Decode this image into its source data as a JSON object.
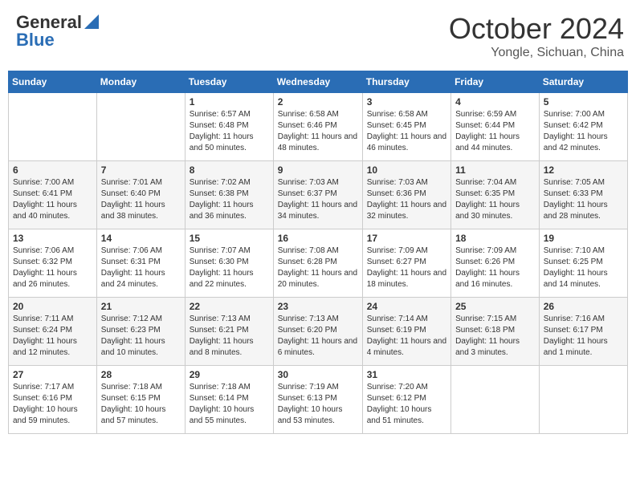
{
  "header": {
    "logo_general": "General",
    "logo_blue": "Blue",
    "month_title": "October 2024",
    "location": "Yongle, Sichuan, China"
  },
  "weekdays": [
    "Sunday",
    "Monday",
    "Tuesday",
    "Wednesday",
    "Thursday",
    "Friday",
    "Saturday"
  ],
  "weeks": [
    [
      {
        "day": "",
        "sunrise": "",
        "sunset": "",
        "daylight": ""
      },
      {
        "day": "",
        "sunrise": "",
        "sunset": "",
        "daylight": ""
      },
      {
        "day": "1",
        "sunrise": "Sunrise: 6:57 AM",
        "sunset": "Sunset: 6:48 PM",
        "daylight": "Daylight: 11 hours and 50 minutes."
      },
      {
        "day": "2",
        "sunrise": "Sunrise: 6:58 AM",
        "sunset": "Sunset: 6:46 PM",
        "daylight": "Daylight: 11 hours and 48 minutes."
      },
      {
        "day": "3",
        "sunrise": "Sunrise: 6:58 AM",
        "sunset": "Sunset: 6:45 PM",
        "daylight": "Daylight: 11 hours and 46 minutes."
      },
      {
        "day": "4",
        "sunrise": "Sunrise: 6:59 AM",
        "sunset": "Sunset: 6:44 PM",
        "daylight": "Daylight: 11 hours and 44 minutes."
      },
      {
        "day": "5",
        "sunrise": "Sunrise: 7:00 AM",
        "sunset": "Sunset: 6:42 PM",
        "daylight": "Daylight: 11 hours and 42 minutes."
      }
    ],
    [
      {
        "day": "6",
        "sunrise": "Sunrise: 7:00 AM",
        "sunset": "Sunset: 6:41 PM",
        "daylight": "Daylight: 11 hours and 40 minutes."
      },
      {
        "day": "7",
        "sunrise": "Sunrise: 7:01 AM",
        "sunset": "Sunset: 6:40 PM",
        "daylight": "Daylight: 11 hours and 38 minutes."
      },
      {
        "day": "8",
        "sunrise": "Sunrise: 7:02 AM",
        "sunset": "Sunset: 6:38 PM",
        "daylight": "Daylight: 11 hours and 36 minutes."
      },
      {
        "day": "9",
        "sunrise": "Sunrise: 7:03 AM",
        "sunset": "Sunset: 6:37 PM",
        "daylight": "Daylight: 11 hours and 34 minutes."
      },
      {
        "day": "10",
        "sunrise": "Sunrise: 7:03 AM",
        "sunset": "Sunset: 6:36 PM",
        "daylight": "Daylight: 11 hours and 32 minutes."
      },
      {
        "day": "11",
        "sunrise": "Sunrise: 7:04 AM",
        "sunset": "Sunset: 6:35 PM",
        "daylight": "Daylight: 11 hours and 30 minutes."
      },
      {
        "day": "12",
        "sunrise": "Sunrise: 7:05 AM",
        "sunset": "Sunset: 6:33 PM",
        "daylight": "Daylight: 11 hours and 28 minutes."
      }
    ],
    [
      {
        "day": "13",
        "sunrise": "Sunrise: 7:06 AM",
        "sunset": "Sunset: 6:32 PM",
        "daylight": "Daylight: 11 hours and 26 minutes."
      },
      {
        "day": "14",
        "sunrise": "Sunrise: 7:06 AM",
        "sunset": "Sunset: 6:31 PM",
        "daylight": "Daylight: 11 hours and 24 minutes."
      },
      {
        "day": "15",
        "sunrise": "Sunrise: 7:07 AM",
        "sunset": "Sunset: 6:30 PM",
        "daylight": "Daylight: 11 hours and 22 minutes."
      },
      {
        "day": "16",
        "sunrise": "Sunrise: 7:08 AM",
        "sunset": "Sunset: 6:28 PM",
        "daylight": "Daylight: 11 hours and 20 minutes."
      },
      {
        "day": "17",
        "sunrise": "Sunrise: 7:09 AM",
        "sunset": "Sunset: 6:27 PM",
        "daylight": "Daylight: 11 hours and 18 minutes."
      },
      {
        "day": "18",
        "sunrise": "Sunrise: 7:09 AM",
        "sunset": "Sunset: 6:26 PM",
        "daylight": "Daylight: 11 hours and 16 minutes."
      },
      {
        "day": "19",
        "sunrise": "Sunrise: 7:10 AM",
        "sunset": "Sunset: 6:25 PM",
        "daylight": "Daylight: 11 hours and 14 minutes."
      }
    ],
    [
      {
        "day": "20",
        "sunrise": "Sunrise: 7:11 AM",
        "sunset": "Sunset: 6:24 PM",
        "daylight": "Daylight: 11 hours and 12 minutes."
      },
      {
        "day": "21",
        "sunrise": "Sunrise: 7:12 AM",
        "sunset": "Sunset: 6:23 PM",
        "daylight": "Daylight: 11 hours and 10 minutes."
      },
      {
        "day": "22",
        "sunrise": "Sunrise: 7:13 AM",
        "sunset": "Sunset: 6:21 PM",
        "daylight": "Daylight: 11 hours and 8 minutes."
      },
      {
        "day": "23",
        "sunrise": "Sunrise: 7:13 AM",
        "sunset": "Sunset: 6:20 PM",
        "daylight": "Daylight: 11 hours and 6 minutes."
      },
      {
        "day": "24",
        "sunrise": "Sunrise: 7:14 AM",
        "sunset": "Sunset: 6:19 PM",
        "daylight": "Daylight: 11 hours and 4 minutes."
      },
      {
        "day": "25",
        "sunrise": "Sunrise: 7:15 AM",
        "sunset": "Sunset: 6:18 PM",
        "daylight": "Daylight: 11 hours and 3 minutes."
      },
      {
        "day": "26",
        "sunrise": "Sunrise: 7:16 AM",
        "sunset": "Sunset: 6:17 PM",
        "daylight": "Daylight: 11 hours and 1 minute."
      }
    ],
    [
      {
        "day": "27",
        "sunrise": "Sunrise: 7:17 AM",
        "sunset": "Sunset: 6:16 PM",
        "daylight": "Daylight: 10 hours and 59 minutes."
      },
      {
        "day": "28",
        "sunrise": "Sunrise: 7:18 AM",
        "sunset": "Sunset: 6:15 PM",
        "daylight": "Daylight: 10 hours and 57 minutes."
      },
      {
        "day": "29",
        "sunrise": "Sunrise: 7:18 AM",
        "sunset": "Sunset: 6:14 PM",
        "daylight": "Daylight: 10 hours and 55 minutes."
      },
      {
        "day": "30",
        "sunrise": "Sunrise: 7:19 AM",
        "sunset": "Sunset: 6:13 PM",
        "daylight": "Daylight: 10 hours and 53 minutes."
      },
      {
        "day": "31",
        "sunrise": "Sunrise: 7:20 AM",
        "sunset": "Sunset: 6:12 PM",
        "daylight": "Daylight: 10 hours and 51 minutes."
      },
      {
        "day": "",
        "sunrise": "",
        "sunset": "",
        "daylight": ""
      },
      {
        "day": "",
        "sunrise": "",
        "sunset": "",
        "daylight": ""
      }
    ]
  ]
}
